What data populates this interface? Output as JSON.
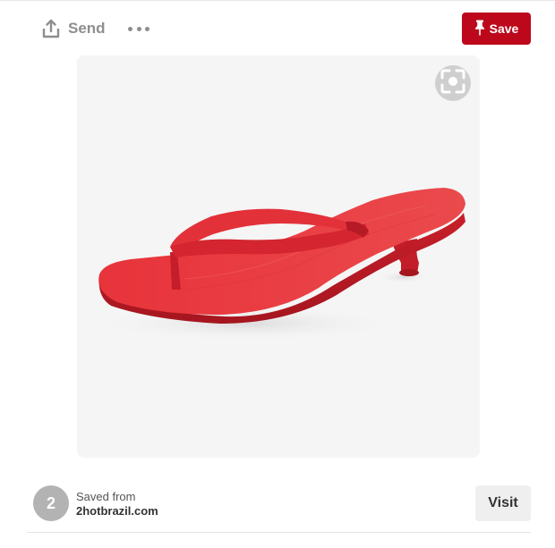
{
  "toolbar": {
    "send_label": "Send",
    "send_icon": "share-upload-icon",
    "more_icon": "ellipsis-icon",
    "save_label": "Save",
    "save_icon": "pushpin-icon",
    "save_color": "#bd081c",
    "muted_color": "#8e8e8e"
  },
  "pin": {
    "image_subject": "red kitten-heel flip-flop sandal",
    "lens_icon": "visual-search-icon",
    "background_color": "#f5f5f5"
  },
  "footer": {
    "saves_count": "2",
    "saved_from_label": "Saved from",
    "source_domain": "2hotbrazil.com",
    "visit_label": "Visit"
  }
}
